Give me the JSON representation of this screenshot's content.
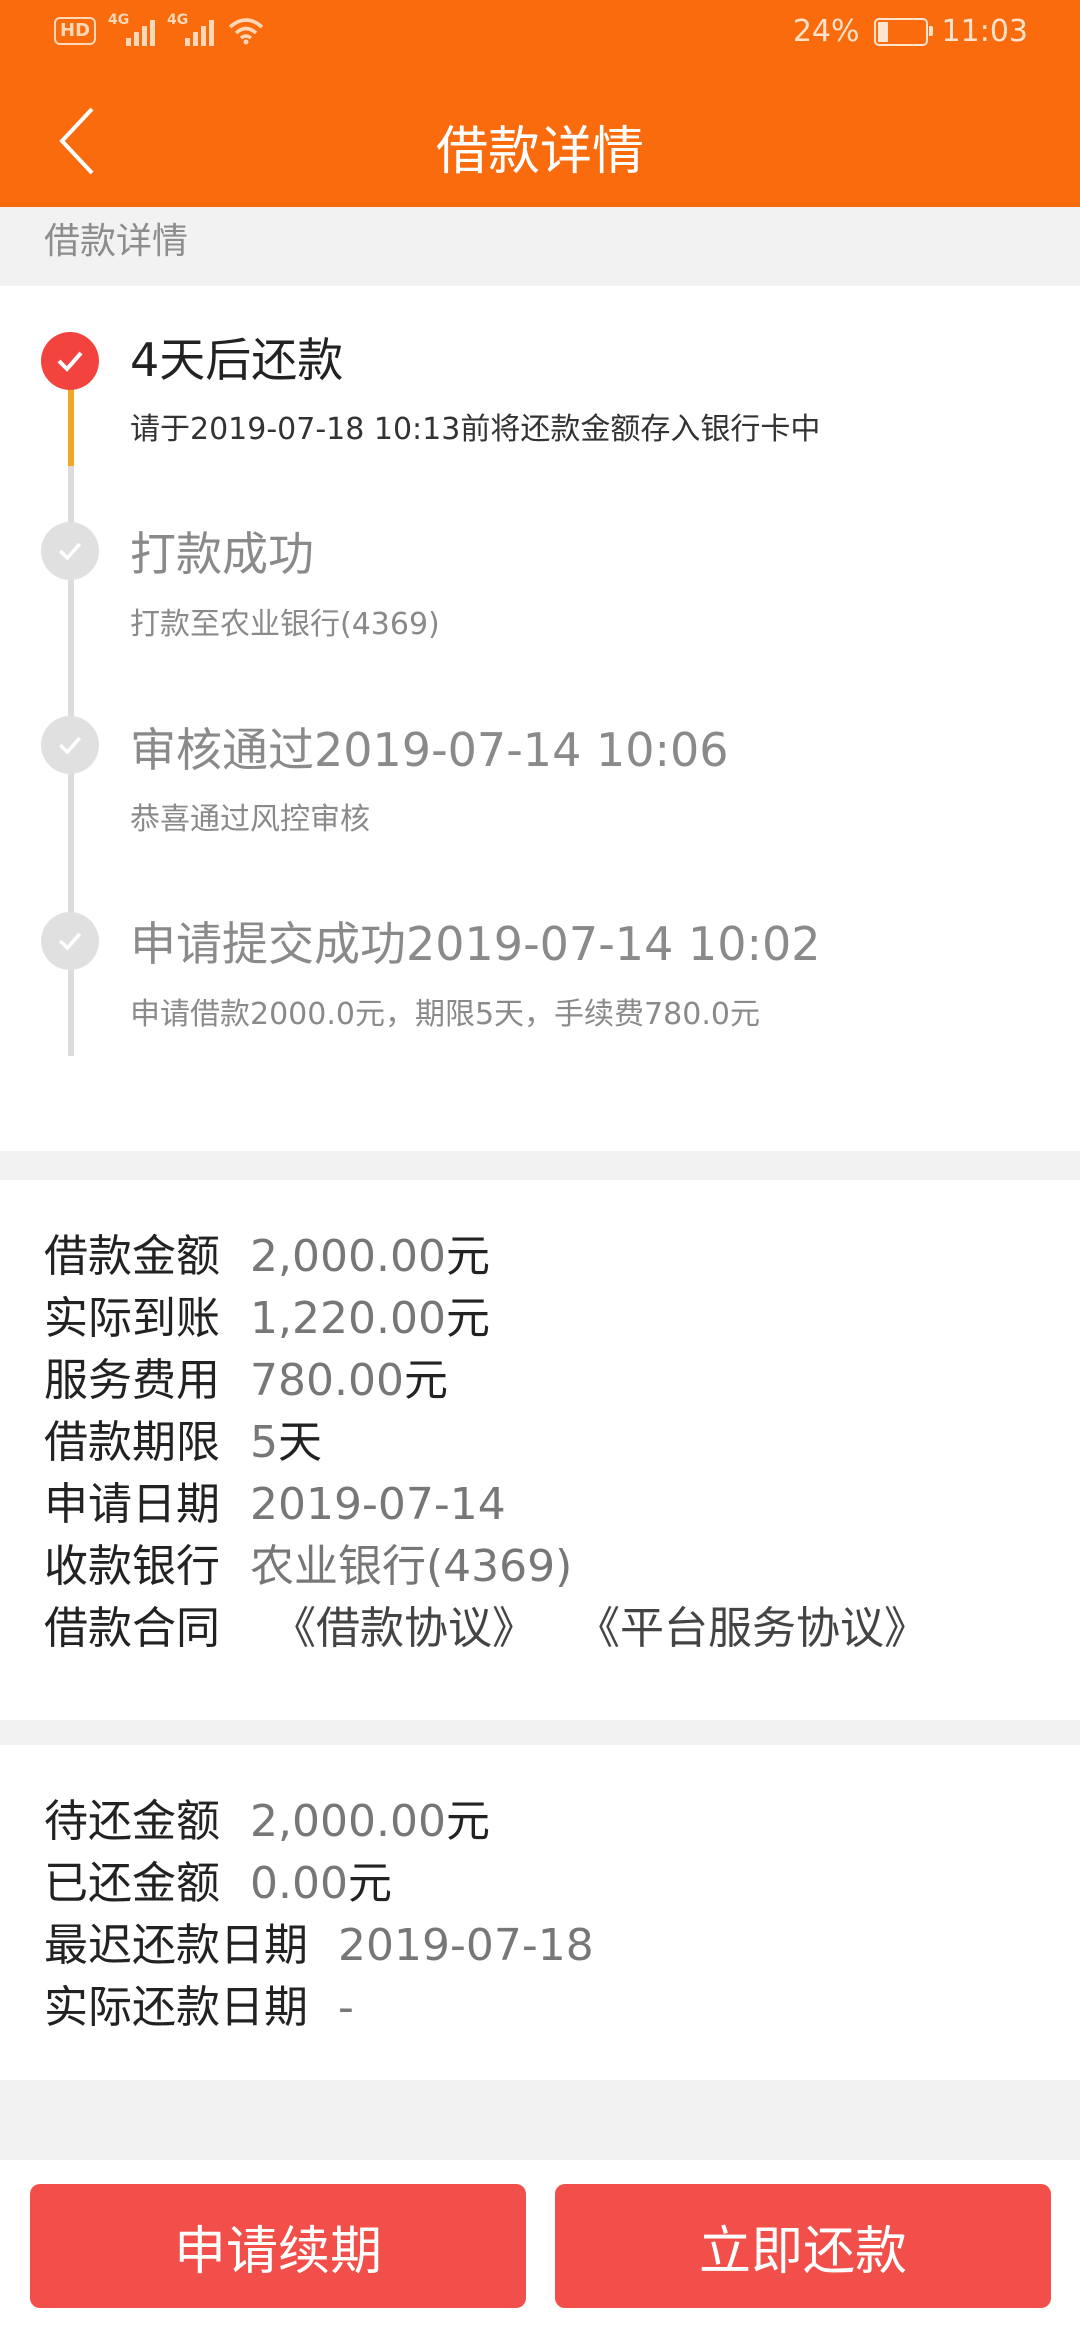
{
  "status_bar": {
    "hd": "HD",
    "net1": "4G",
    "net2": "4G",
    "battery": "24%",
    "time": "11:03"
  },
  "nav": {
    "title": "借款详情"
  },
  "section_label": "借款详情",
  "timeline": [
    {
      "title": "4天后还款",
      "desc": "请于2019-07-18 10:13前将还款金额存入银行卡中",
      "active": true
    },
    {
      "title": "打款成功",
      "desc": "打款至农业银行(4369)",
      "active": false
    },
    {
      "title": "审核通过2019-07-14 10:06",
      "desc": "恭喜通过风控审核",
      "active": false
    },
    {
      "title": "申请提交成功2019-07-14 10:02",
      "desc": "申请借款2000.0元，期限5天，手续费780.0元",
      "active": false
    }
  ],
  "loan_info": {
    "amount": {
      "label": "借款金额",
      "value": "2,000.00",
      "unit": "元"
    },
    "received": {
      "label": "实际到账",
      "value": "1,220.00",
      "unit": "元"
    },
    "fee": {
      "label": "服务费用",
      "value": "780.00",
      "unit": "元"
    },
    "term": {
      "label": "借款期限",
      "value": "5",
      "unit": "天"
    },
    "apply_date": {
      "label": "申请日期",
      "value": "2019-07-14"
    },
    "bank": {
      "label": "收款银行",
      "value": "农业银行(4369)"
    },
    "contract": {
      "label": "借款合同",
      "link1": "《借款协议》",
      "link2": "《平台服务协议》"
    }
  },
  "repay_info": {
    "pending": {
      "label": "待还金额",
      "value": "2,000.00",
      "unit": "元"
    },
    "paid": {
      "label": "已还金额",
      "value": "0.00",
      "unit": "元"
    },
    "latest_date": {
      "label": "最迟还款日期",
      "value": "2019-07-18"
    },
    "actual_date": {
      "label": "实际还款日期",
      "value": "-"
    }
  },
  "actions": {
    "renew": "申请续期",
    "repay": "立即还款"
  },
  "colors": {
    "brand_orange": "#f96b0d",
    "button_red": "#f24f4a",
    "active_node": "#f3433f",
    "active_line": "#f0a820"
  }
}
